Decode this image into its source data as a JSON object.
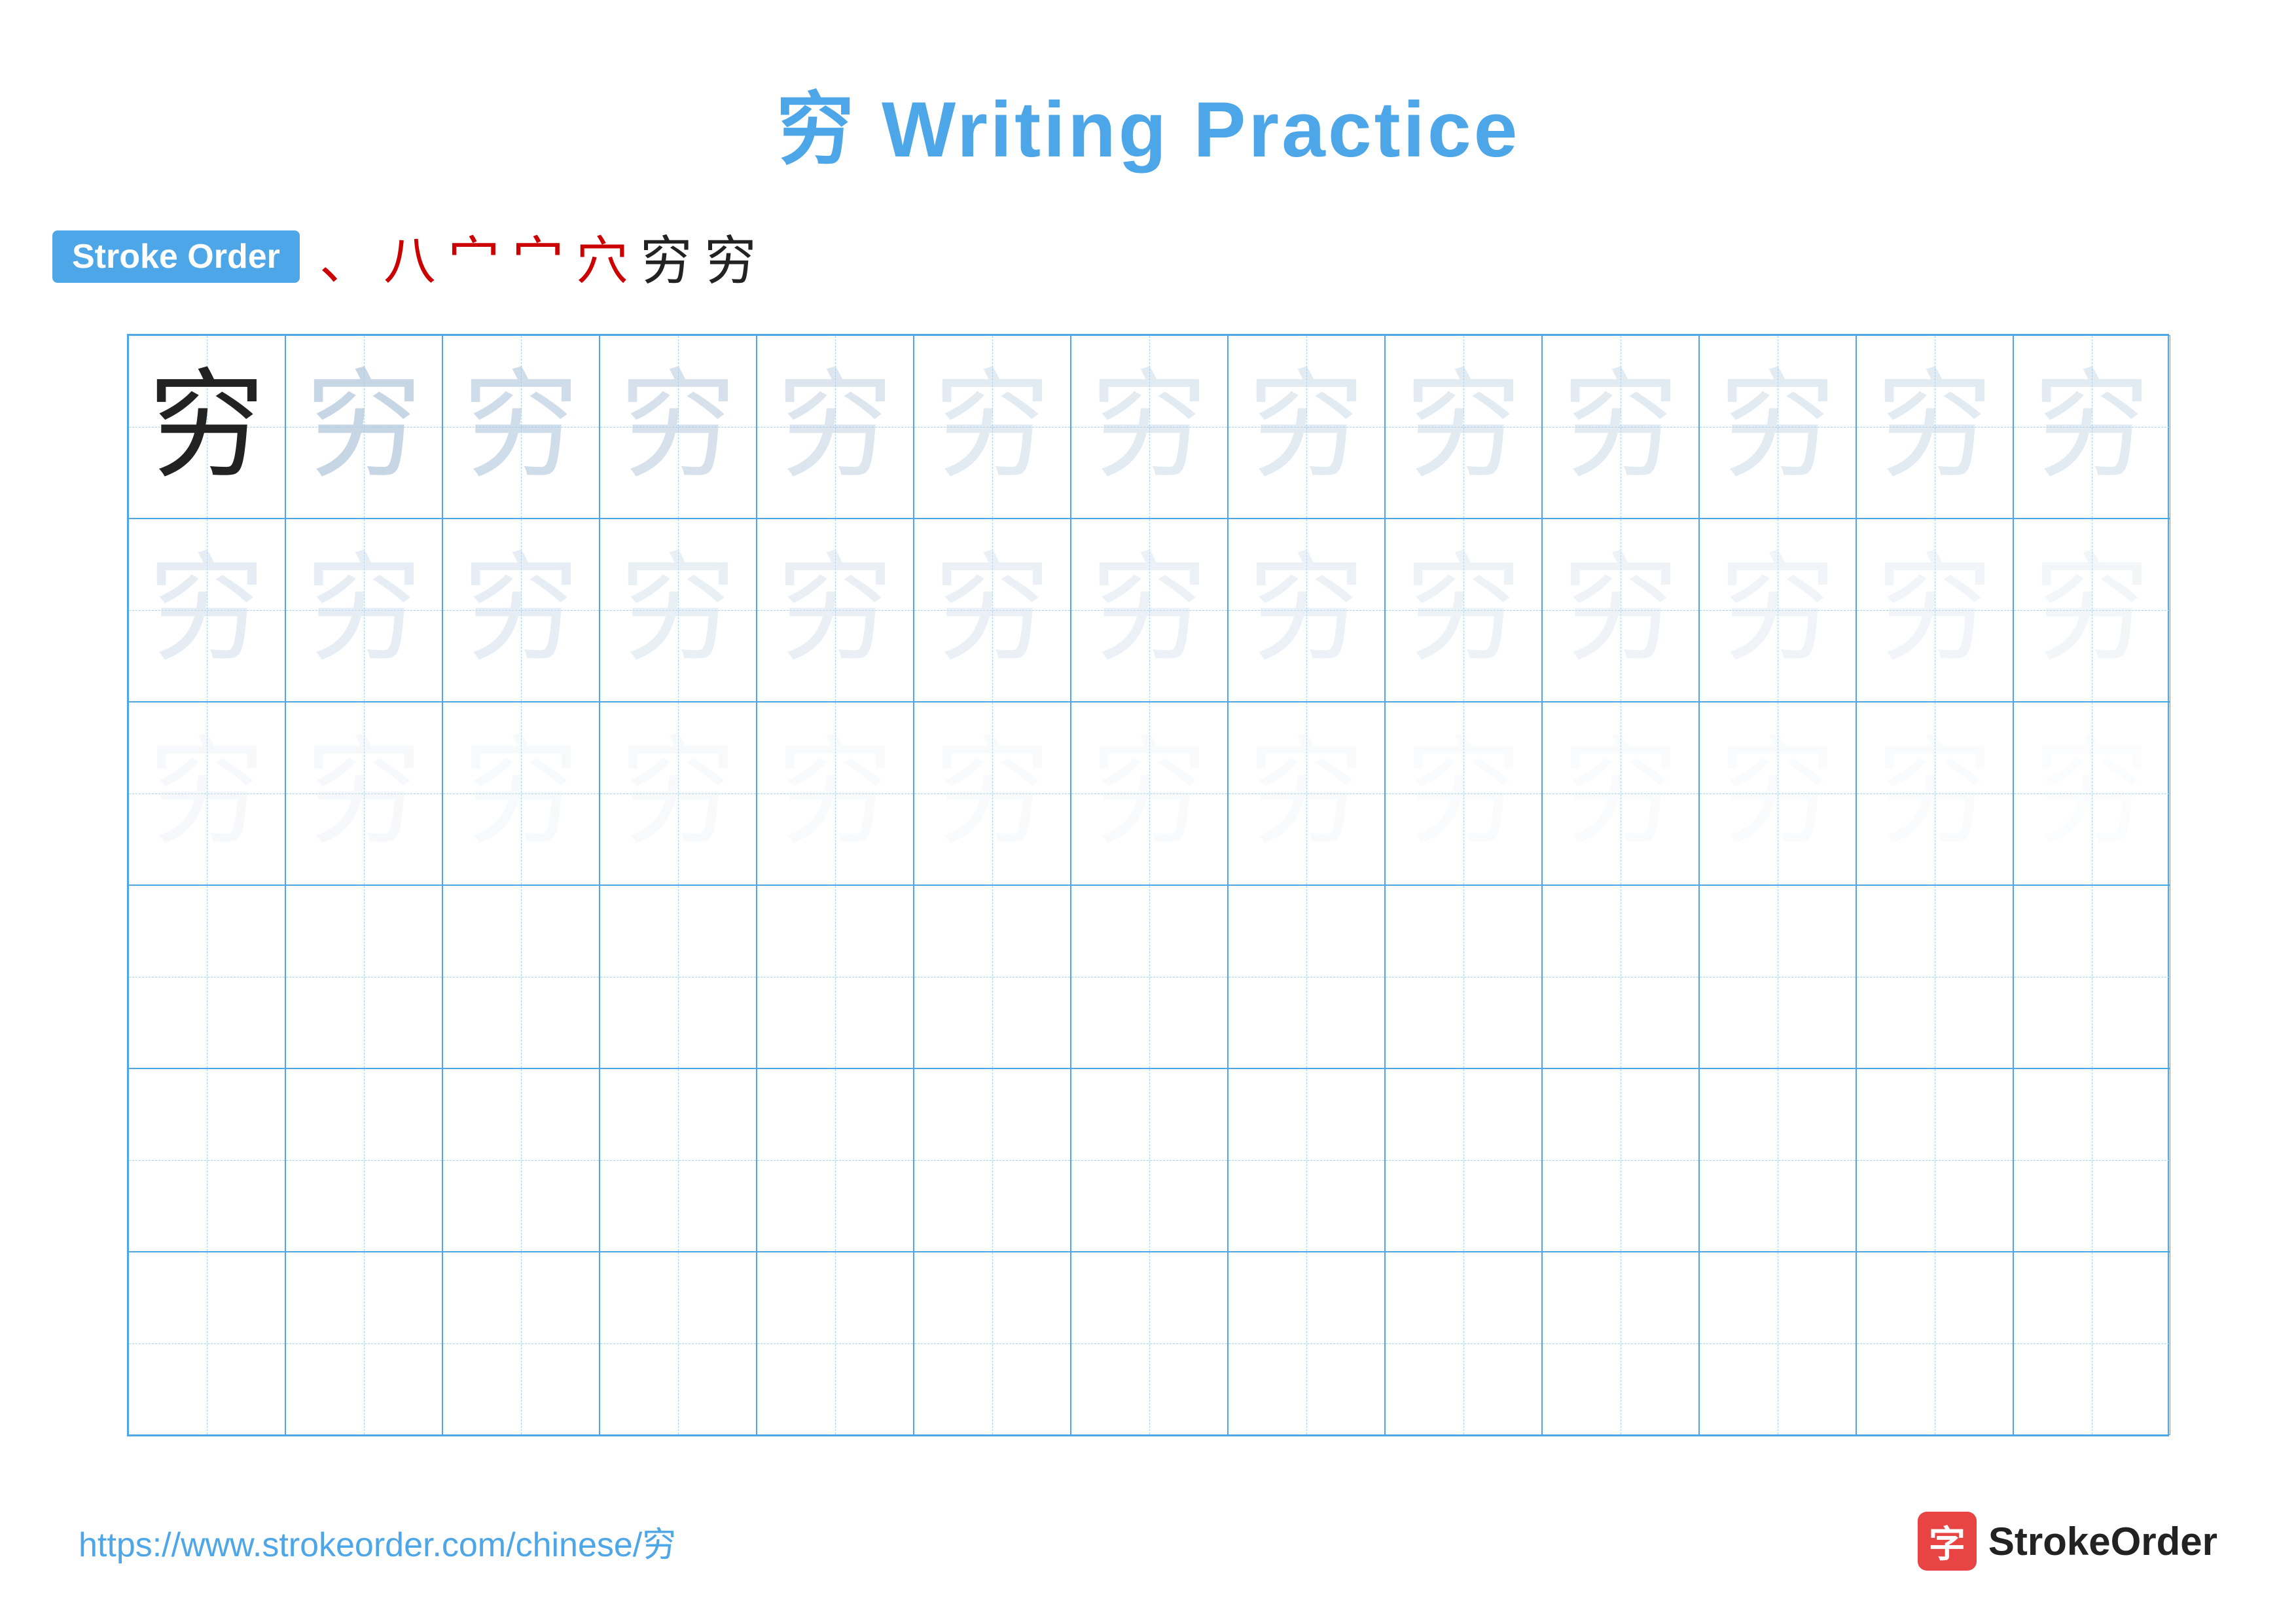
{
  "title": {
    "chinese_char": "穷",
    "label": "Writing Practice",
    "full_title": "穷 Writing Practice"
  },
  "stroke_order": {
    "badge_label": "Stroke Order",
    "strokes": [
      "、",
      "八",
      "宀",
      "宀",
      "穴",
      "穷",
      "穷"
    ]
  },
  "grid": {
    "cols": 13,
    "rows": 6,
    "char": "穷",
    "row_types": [
      "solid_then_dark",
      "mid_fade",
      "light_fade",
      "empty",
      "empty",
      "empty"
    ]
  },
  "footer": {
    "url": "https://www.strokeorder.com/chinese/穷",
    "logo_char": "字",
    "logo_text": "StrokeOrder"
  }
}
